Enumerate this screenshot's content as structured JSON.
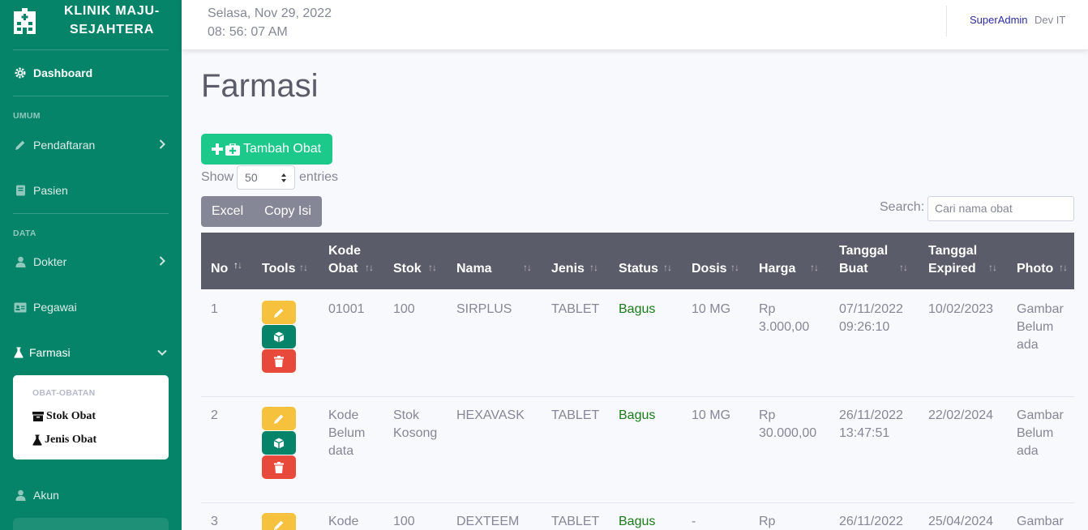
{
  "brand": {
    "line1": "KLINIK MAJU-",
    "line2": "SEJAHTERA"
  },
  "sidebar": {
    "dashboard": "Dashboard",
    "heading_umum": "UMUM",
    "pendaftaran": "Pendaftaran",
    "pasien": "Pasien",
    "heading_data": "DATA",
    "dokter": "Dokter",
    "pegawai": "Pegawai",
    "farmasi": "Farmasi",
    "collapse_heading": "OBAT-OBATAN",
    "stok_obat": "Stok Obat",
    "jenis_obat": "Jenis Obat",
    "akun": "Akun"
  },
  "topbar": {
    "date": "Selasa, Nov 29, 2022",
    "time": "08: 56: 07 AM",
    "user": "SuperAdmin",
    "role": "Dev IT"
  },
  "page": {
    "title": "Farmasi",
    "add_button": "Tambah Obat",
    "show_label": "Show",
    "show_value": "50",
    "entries_label": "entries",
    "excel_button": "Excel",
    "copy_button": "Copy Isi",
    "search_label": "Search:",
    "search_placeholder": "Cari nama obat"
  },
  "table": {
    "headers": {
      "no": "No",
      "tools": "Tools",
      "kode1": "Kode",
      "kode2": "Obat",
      "stok": "Stok",
      "nama": "Nama",
      "jenis": "Jenis",
      "status": "Status",
      "dosis": "Dosis",
      "harga": "Harga",
      "tgl_buat1": "Tanggal",
      "tgl_buat2": "Buat",
      "tgl_exp1": "Tanggal",
      "tgl_exp2": "Expired",
      "photo": "Photo"
    },
    "rows": [
      {
        "no": "1",
        "kode": [
          "01001"
        ],
        "stok": [
          "100"
        ],
        "nama": "SIRPLUS",
        "jenis": "TABLET",
        "status": "Bagus",
        "dosis": "10 MG",
        "harga": [
          "Rp",
          "3.000,00"
        ],
        "buat": [
          "07/11/2022",
          "09:26:10"
        ],
        "expired": "10/02/2023",
        "photo": [
          "Gambar",
          "Belum",
          "ada"
        ]
      },
      {
        "no": "2",
        "kode": [
          "Kode",
          "Belum",
          "data"
        ],
        "stok": [
          "Stok",
          "Kosong"
        ],
        "nama": "HEXAVASK",
        "jenis": "TABLET",
        "status": "Bagus",
        "dosis": "10 MG",
        "harga": [
          "Rp",
          "30.000,00"
        ],
        "buat": [
          "26/11/2022",
          "13:47:51"
        ],
        "expired": "22/02/2024",
        "photo": [
          "Gambar",
          "Belum",
          "ada"
        ]
      },
      {
        "no": "3",
        "kode": [
          "Kode"
        ],
        "stok": [
          "100"
        ],
        "nama": "DEXTEEM",
        "jenis": "TABLET",
        "status": "Bagus",
        "dosis": "-",
        "harga": [
          "Rp"
        ],
        "buat": [
          "26/11/2022"
        ],
        "expired": "25/04/2024",
        "photo": [
          "Gambar"
        ]
      }
    ]
  },
  "colors": {
    "sidebar": "#068469",
    "success": "#1cc88a",
    "warning": "#f6c23e",
    "danger": "#e74a3b",
    "table_header": "#5a5c69"
  }
}
